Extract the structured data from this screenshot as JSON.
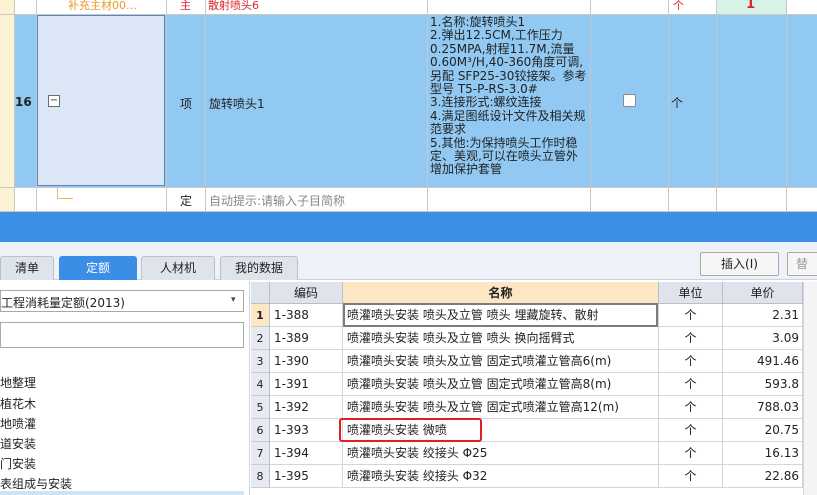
{
  "top_grid": {
    "prev_row": {
      "text_partial": "补充主材00…",
      "type": "主",
      "name": "散射喷头6",
      "unit": "个",
      "qty": "1"
    },
    "row": {
      "number": "16",
      "collapse_symbol": "−",
      "type": "项",
      "name": "旋转喷头1",
      "description": "1.名称:旋转喷头1\n2.弹出12.5CM,工作压力\n0.25MPA,射程11.7M,流量\n0.60M³/H,40-360角度可调,\n另配 SFP25-30铰接架。参考\n型号 T5-P-RS-3.0#\n3.连接形式:螺纹连接\n4.满足图纸设计文件及相关规\n范要求\n5.其他:为保持喷头工作时稳\n定、美观,可以在喷头立管外\n增加保护套管",
      "unit": "个"
    },
    "sub_row": {
      "type": "定",
      "hint": "自动提示:请输入子目简称"
    }
  },
  "tabs": [
    {
      "label": "清单",
      "active": false
    },
    {
      "label": "定额",
      "active": true
    },
    {
      "label": "人材机",
      "active": false
    },
    {
      "label": "我的数据",
      "active": false
    }
  ],
  "buttons": {
    "insert": "插入(I)",
    "replace_partial": "替"
  },
  "left_pane": {
    "quota_select": "工程消耗量定额(2013)",
    "search_value": "",
    "tree_items": [
      "地整理",
      "植花木",
      "地喷灌",
      "道安装",
      "门安装",
      "表组成与安装"
    ]
  },
  "table": {
    "columns": [
      "编码",
      "名称",
      "单位",
      "单价"
    ],
    "rows": [
      {
        "no": "1",
        "code": "1-388",
        "name": "喷灌喷头安装 喷头及立管 喷头 埋藏旋转、散射",
        "unit": "个",
        "price": "2.31"
      },
      {
        "no": "2",
        "code": "1-389",
        "name": "喷灌喷头安装 喷头及立管 喷头 换向摇臂式",
        "unit": "个",
        "price": "3.09"
      },
      {
        "no": "3",
        "code": "1-390",
        "name": "喷灌喷头安装 喷头及立管 固定式喷灌立管高6(m)",
        "unit": "个",
        "price": "491.46"
      },
      {
        "no": "4",
        "code": "1-391",
        "name": "喷灌喷头安装 喷头及立管 固定式喷灌立管高8(m)",
        "unit": "个",
        "price": "593.8"
      },
      {
        "no": "5",
        "code": "1-392",
        "name": "喷灌喷头安装 喷头及立管 固定式喷灌立管高12(m)",
        "unit": "个",
        "price": "788.03"
      },
      {
        "no": "6",
        "code": "1-393",
        "name": "喷灌喷头安装 微喷",
        "unit": "个",
        "price": "20.75"
      },
      {
        "no": "7",
        "code": "1-394",
        "name": "喷灌喷头安装 绞接头 Φ25",
        "unit": "个",
        "price": "16.13"
      },
      {
        "no": "8",
        "code": "1-395",
        "name": "喷灌喷头安装 绞接头 Φ32",
        "unit": "个",
        "price": "22.86"
      }
    ]
  },
  "colors": {
    "selected_row": "#91c9f3",
    "accent_tab": "#3a8ee6",
    "highlight_box": "#e0201e",
    "header_active": "#fce6c4"
  }
}
